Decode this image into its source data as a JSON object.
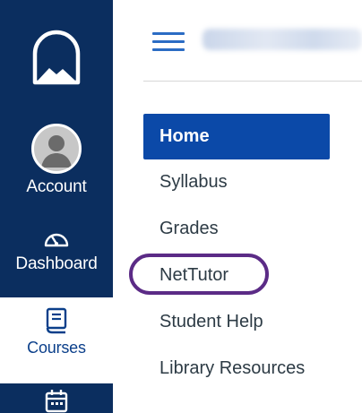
{
  "global_nav": {
    "items": [
      {
        "id": "logo",
        "label": ""
      },
      {
        "id": "account",
        "label": "Account"
      },
      {
        "id": "dashboard",
        "label": "Dashboard"
      },
      {
        "id": "courses",
        "label": "Courses"
      },
      {
        "id": "calendar",
        "label": ""
      }
    ],
    "colors": {
      "background": "#0b2e5f",
      "active_text": "#0b3f8a"
    }
  },
  "course_nav": {
    "items": [
      {
        "label": "Home",
        "active": true
      },
      {
        "label": "Syllabus"
      },
      {
        "label": "Grades"
      },
      {
        "label": "NetTutor"
      },
      {
        "label": "Student Help"
      },
      {
        "label": "Library Resources"
      }
    ],
    "active_color": "#0b49a8",
    "highlight_color": "#5b2b86"
  }
}
